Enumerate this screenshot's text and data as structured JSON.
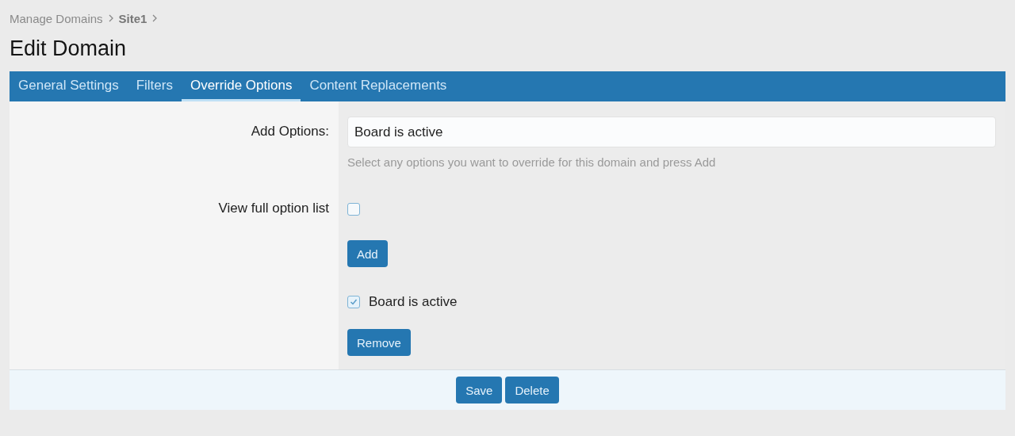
{
  "breadcrumb": [
    {
      "label": "Manage Domains",
      "current": false
    },
    {
      "label": "Site1",
      "current": true
    }
  ],
  "title": "Edit Domain",
  "tabs": [
    {
      "label": "General Settings",
      "selected": false
    },
    {
      "label": "Filters",
      "selected": false
    },
    {
      "label": "Override Options",
      "selected": true
    },
    {
      "label": "Content Replacements",
      "selected": false
    }
  ],
  "add_options": {
    "label": "Add Options:",
    "value": "Board is active",
    "hint": "Select any options you want to override for this domain and press Add"
  },
  "full_list": {
    "label": "View full option list",
    "checked": false
  },
  "add_button": "Add",
  "overridden_options": [
    {
      "label": "Board is active",
      "checked": true
    }
  ],
  "remove_button": "Remove",
  "footer_buttons": [
    "Save",
    "Delete"
  ]
}
